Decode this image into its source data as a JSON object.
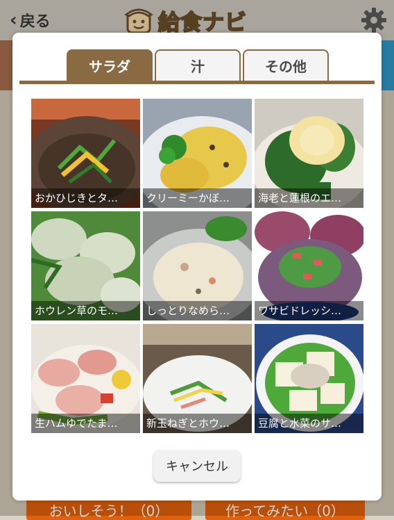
{
  "header": {
    "back_label": "戻る",
    "app_title": "給食ナビ"
  },
  "background": {
    "left_button": "おいしそう！（0）",
    "right_button": "作ってみたい（0）"
  },
  "modal": {
    "tabs": [
      "サラダ",
      "汁",
      "その他"
    ],
    "active_tab": "サラダ",
    "dishes": [
      {
        "caption": "おかひじきとタ…",
        "icon": "photo-dish"
      },
      {
        "caption": "クリーミーかぼ…",
        "icon": "photo-dish"
      },
      {
        "caption": "海老と蓮根のエ…",
        "icon": "photo-dish"
      },
      {
        "caption": "ホウレン草のモ…",
        "icon": "photo-dish"
      },
      {
        "caption": "しっとりなめら…",
        "icon": "photo-dish"
      },
      {
        "caption": "ワサビドレッシ…",
        "icon": "photo-dish"
      },
      {
        "caption": "生ハムゆでたま…",
        "icon": "photo-dish"
      },
      {
        "caption": "新玉ねぎとホウ…",
        "icon": "photo-dish"
      },
      {
        "caption": "豆腐と水菜のサ…",
        "icon": "photo-dish"
      }
    ],
    "cancel_label": "キャンセル"
  },
  "colors": {
    "tab_active": "#8a6a43",
    "bottom_button": "#e0600b",
    "accent_blue": "#2f96c4"
  }
}
